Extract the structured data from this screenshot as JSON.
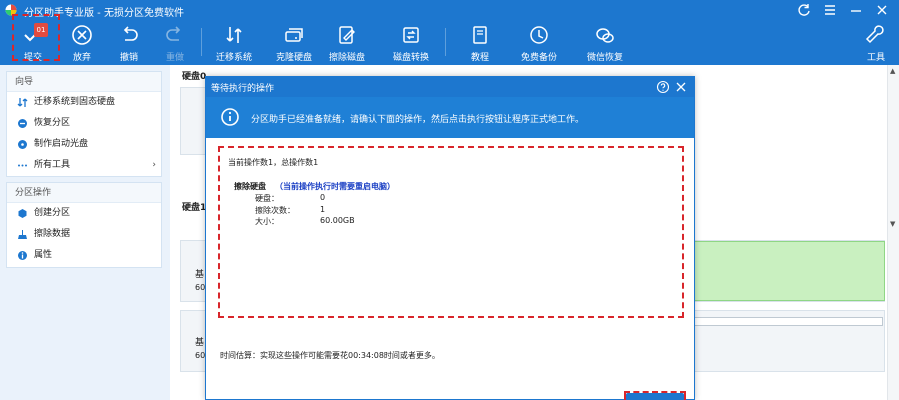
{
  "app": {
    "title": "分区助手专业版 - 无损分区免费软件"
  },
  "toolbar": {
    "submit": "提交",
    "submit_badge": "01",
    "discard": "放弃",
    "undo": "撤销",
    "redo": "重做",
    "migrate_os": "迁移系统",
    "clone_disk": "克隆硬盘",
    "wipe_disk": "擦除磁盘",
    "convert_disk": "磁盘转换",
    "tutorial": "教程",
    "free_backup": "免费备份",
    "wechat_recovery": "微信恢复",
    "tools": "工具"
  },
  "sidebar": {
    "wizard_header": "向导",
    "wizard_items": [
      "迁移系统到固态硬盘",
      "恢复分区",
      "制作启动光盘",
      "所有工具"
    ],
    "partition_header": "分区操作",
    "partition_items": [
      "创建分区",
      "擦除数据",
      "属性"
    ]
  },
  "main": {
    "disk0_label": "硬盘0",
    "disk1_label": "硬盘1",
    "row1_text": "基",
    "row1_sub": "60",
    "row2_text": "基",
    "row2_sub": "60"
  },
  "dialog": {
    "title": "等待执行的操作",
    "info": "分区助手已经准备就绪，请确认下面的操作，然后点击执行按钮让程序正式地工作。",
    "current_op": "当前操作数1，总操作数1",
    "op_name": "擦除硬盘",
    "op_note": "（当前操作执行时需要重启电脑）",
    "details": [
      {
        "key": "硬盘：",
        "value": "0"
      },
      {
        "key": "擦除次数：",
        "value": "1"
      },
      {
        "key": "大小：",
        "value": "60.00GB"
      }
    ],
    "estimate": "时间估算：实现这些操作可能需要花00:34:08时间或者更多。"
  },
  "colors": {
    "brand": "#1d77cf",
    "highlight": "#d8262b",
    "op_note": "#1a3fc4"
  }
}
